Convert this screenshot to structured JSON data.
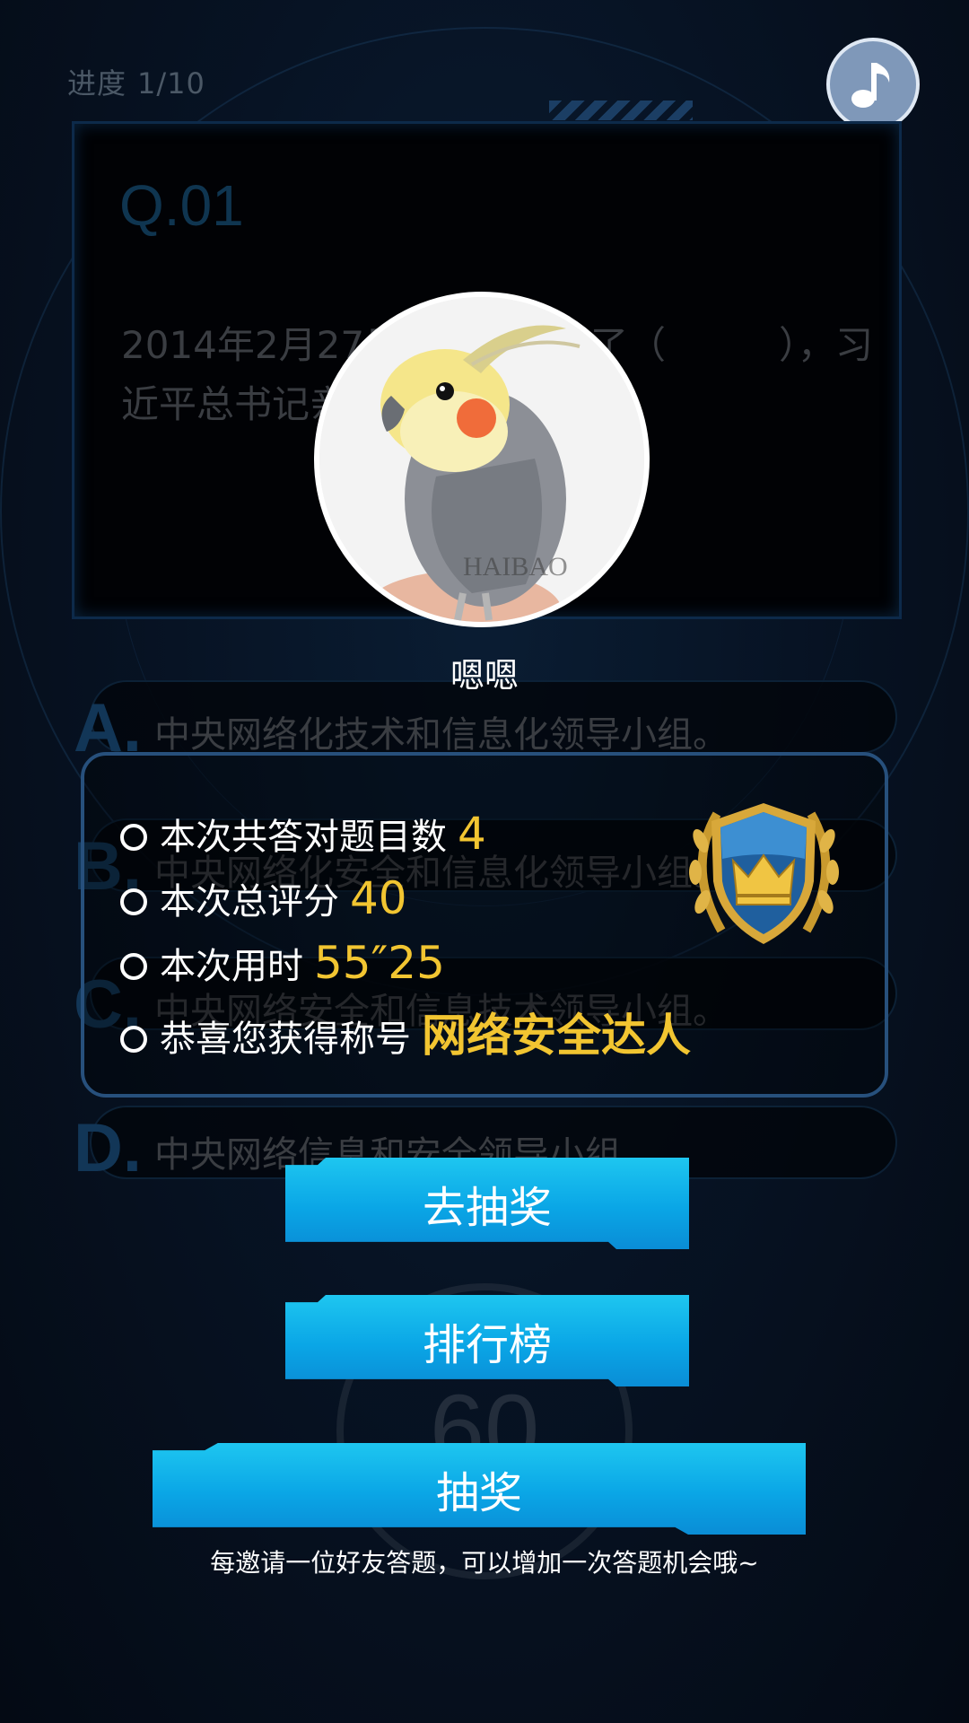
{
  "header": {
    "progress_label": "进度",
    "progress_value": "1/10"
  },
  "icons": {
    "music": "music-note-icon",
    "crown_badge": "crown-shield-badge-icon"
  },
  "question": {
    "number": "Q.01",
    "text": "2014年2月27日，中央成立了（　　　），习近平总书记亲自担任组长。"
  },
  "options": [
    {
      "letter": "A.",
      "text": "中央网络化技术和信息化领导小组。"
    },
    {
      "letter": "B.",
      "text": "中央网络化安全和信息化领导小组。"
    },
    {
      "letter": "C.",
      "text": "中央网络安全和信息技术领导小组。"
    },
    {
      "letter": "D.",
      "text": "中央网络信息和安全领导小组。"
    }
  ],
  "user": {
    "nickname": "嗯嗯",
    "avatar_watermark": "HAIBAO"
  },
  "result": {
    "correct_label": "本次共答对题目数",
    "correct_value": "4",
    "score_label": "本次总评分",
    "score_value": "40",
    "time_label": "本次用时",
    "time_value": "55″25",
    "title_label": "恭喜您获得称号",
    "title_value": "网络安全达人"
  },
  "timer": {
    "value": "60"
  },
  "buttons": {
    "go_draw": "去抽奖",
    "ranking": "排行榜",
    "draw": "抽奖"
  },
  "invite_text": "每邀请一位好友答题，可以增加一次答题机会哦~",
  "colors": {
    "accent_yellow": "#f2c531",
    "button_blue": "#0aa6e6",
    "frame_blue": "#27507c"
  }
}
